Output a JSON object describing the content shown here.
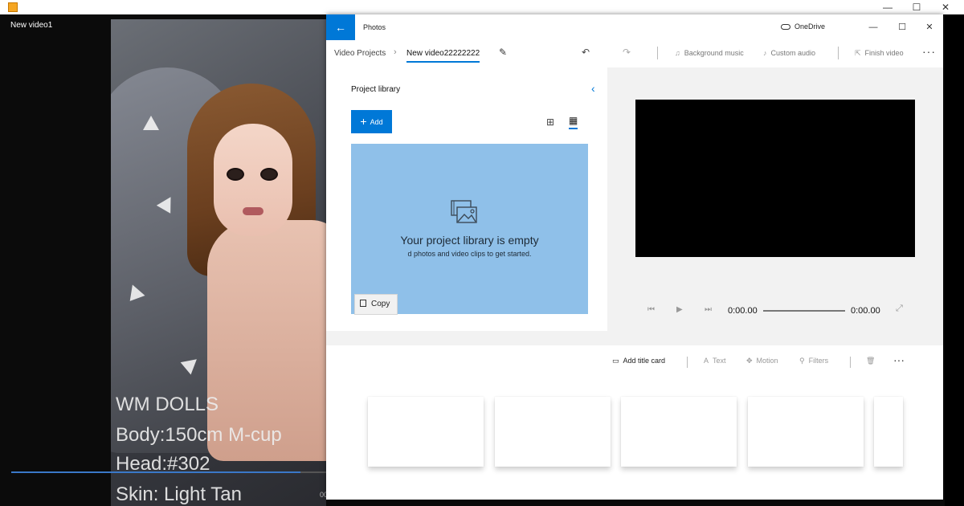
{
  "player": {
    "video_title": "New video1",
    "time_stub": "00",
    "overlay_lines": [
      "WM DOLLS",
      "Body:150cm M-cup",
      "Head:#302",
      "Skin: Light Tan"
    ]
  },
  "outer_window": {
    "minimize": "—",
    "maximize": "☐",
    "close": "✕"
  },
  "photos": {
    "app_title": "Photos",
    "back_glyph": "←",
    "onedrive_label": "OneDrive",
    "controls": {
      "minimize": "—",
      "maximize": "☐",
      "close": "✕"
    },
    "breadcrumb": {
      "parent": "Video Projects",
      "separator": "›",
      "current": "New video22222222"
    },
    "toolbar": {
      "undo": "↶",
      "redo": "↷",
      "background_music": "Background music",
      "custom_audio": "Custom audio",
      "finish_video": "Finish video",
      "more": "···"
    },
    "library": {
      "title": "Project library",
      "collapse_glyph": "‹",
      "add_label": "Add",
      "empty_title": "Your project library is empty",
      "empty_subtitle": "d photos and video clips to get started.",
      "copy_tooltip": "Copy"
    },
    "playback": {
      "current_time": "0:00.00",
      "total_time": "0:00.00"
    },
    "storyboard": {
      "add_title_card": "Add title card",
      "text": "Text",
      "motion": "Motion",
      "filters": "Filters",
      "more": "···",
      "card_count": 5
    }
  }
}
